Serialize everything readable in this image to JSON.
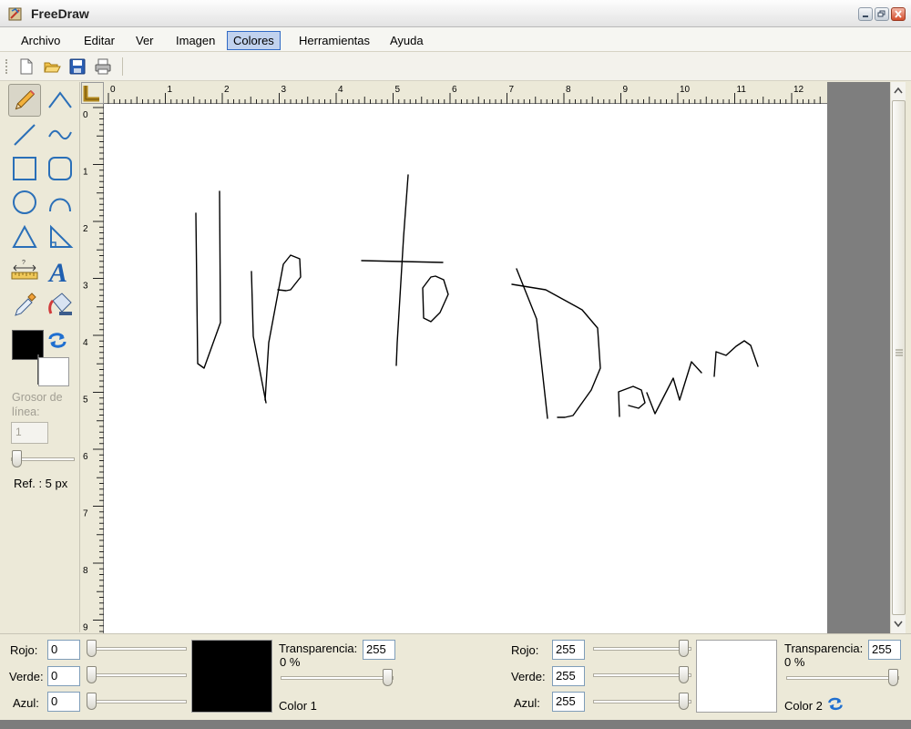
{
  "window": {
    "title": "FreeDraw"
  },
  "menu": {
    "items": [
      {
        "label": "Archivo"
      },
      {
        "label": "Editar"
      },
      {
        "label": "Ver"
      },
      {
        "label": "Imagen"
      },
      {
        "label": "Colores",
        "active": true
      },
      {
        "label": "Herramientas"
      },
      {
        "label": "Ayuda"
      }
    ]
  },
  "toolbar": {
    "icons": [
      "new-document-icon",
      "open-folder-icon",
      "save-icon",
      "print-icon"
    ]
  },
  "tools": {
    "items": [
      "pencil",
      "curve",
      "line",
      "freeform",
      "rectangle",
      "rounded-rectangle",
      "ellipse",
      "arc",
      "triangle",
      "right-triangle",
      "measure",
      "text",
      "eyedropper",
      "paint-bucket"
    ],
    "selected": "pencil"
  },
  "stroke": {
    "label": "Grosor de línea:",
    "value": "1",
    "ref_label": "Ref. : 5 px"
  },
  "rulers": {
    "horizontal": [
      "0",
      "1",
      "2",
      "3",
      "4",
      "5",
      "6",
      "7",
      "8",
      "9",
      "10",
      "11",
      "12"
    ],
    "vertical": [
      "0",
      "1",
      "2",
      "3",
      "4",
      "5",
      "6",
      "7",
      "8",
      "9"
    ]
  },
  "canvas": {
    "handwritten_text": "Up to Down",
    "stroke_color": "#000000"
  },
  "colors": {
    "color1": {
      "label": "Color 1",
      "rojo_label": "Rojo:",
      "rojo": "0",
      "verde_label": "Verde:",
      "verde": "0",
      "azul_label": "Azul:",
      "azul": "0",
      "transparency_label": "Transparencia:",
      "transparency": "255",
      "transparency_pct": "0 %",
      "hex": "#000000"
    },
    "color2": {
      "label": "Color 2",
      "rojo_label": "Rojo:",
      "rojo": "255",
      "verde_label": "Verde:",
      "verde": "255",
      "azul_label": "Azul:",
      "azul": "255",
      "transparency_label": "Transparencia:",
      "transparency": "255",
      "transparency_pct": "0 %",
      "hex": "#ffffff"
    }
  }
}
